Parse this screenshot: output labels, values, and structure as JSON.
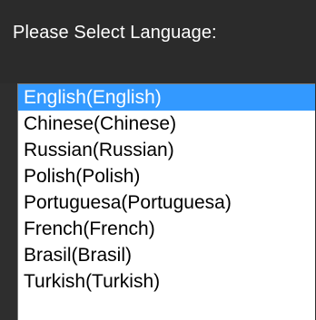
{
  "prompt": "Please Select Language:",
  "languages": [
    {
      "label": "English(English)",
      "selected": true
    },
    {
      "label": "Chinese(Chinese)",
      "selected": false
    },
    {
      "label": "Russian(Russian)",
      "selected": false
    },
    {
      "label": "Polish(Polish)",
      "selected": false
    },
    {
      "label": "Portuguesa(Portuguesa)",
      "selected": false
    },
    {
      "label": "French(French)",
      "selected": false
    },
    {
      "label": "Brasil(Brasil)",
      "selected": false
    },
    {
      "label": "Turkish(Turkish)",
      "selected": false
    }
  ],
  "colors": {
    "background": "#2b2b2b",
    "selection": "#3399ff"
  }
}
